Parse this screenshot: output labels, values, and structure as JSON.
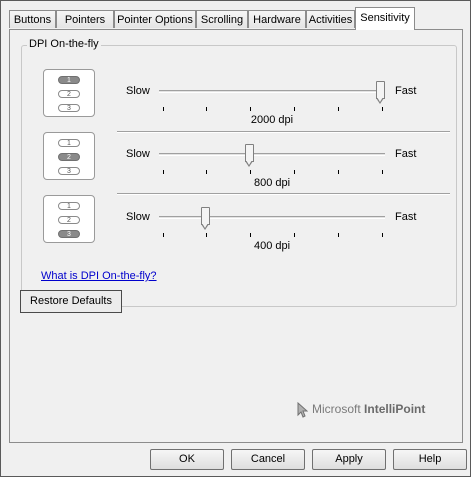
{
  "tabs": [
    {
      "label": "Buttons",
      "active": false
    },
    {
      "label": "Pointers",
      "active": false
    },
    {
      "label": "Pointer Options",
      "active": false
    },
    {
      "label": "Scrolling",
      "active": false
    },
    {
      "label": "Hardware",
      "active": false
    },
    {
      "label": "Activities",
      "active": false
    },
    {
      "label": "Sensitivity",
      "active": true
    }
  ],
  "group": {
    "title": "DPI On-the-fly",
    "rows": [
      {
        "selected": 1,
        "slow_label": "Slow",
        "fast_label": "Fast",
        "value_label": "2000 dpi",
        "level": 1.0
      },
      {
        "selected": 2,
        "slow_label": "Slow",
        "fast_label": "Fast",
        "value_label": "800 dpi",
        "level": 0.4
      },
      {
        "selected": 3,
        "slow_label": "Slow",
        "fast_label": "Fast",
        "value_label": "400 dpi",
        "level": 0.2
      }
    ],
    "pill_labels": [
      "1",
      "2",
      "3"
    ],
    "help_link": "What is DPI On-the-fly?"
  },
  "restore_button": "Restore Defaults",
  "branding": {
    "prefix": "Microsoft",
    "product": "IntelliPoint",
    "icon": "mouse-pointer-icon"
  },
  "footer": {
    "ok": "OK",
    "cancel": "Cancel",
    "apply": "Apply",
    "help": "Help"
  },
  "colors": {
    "link": "#0000cc",
    "selected_pill": "#8a8a8a"
  }
}
